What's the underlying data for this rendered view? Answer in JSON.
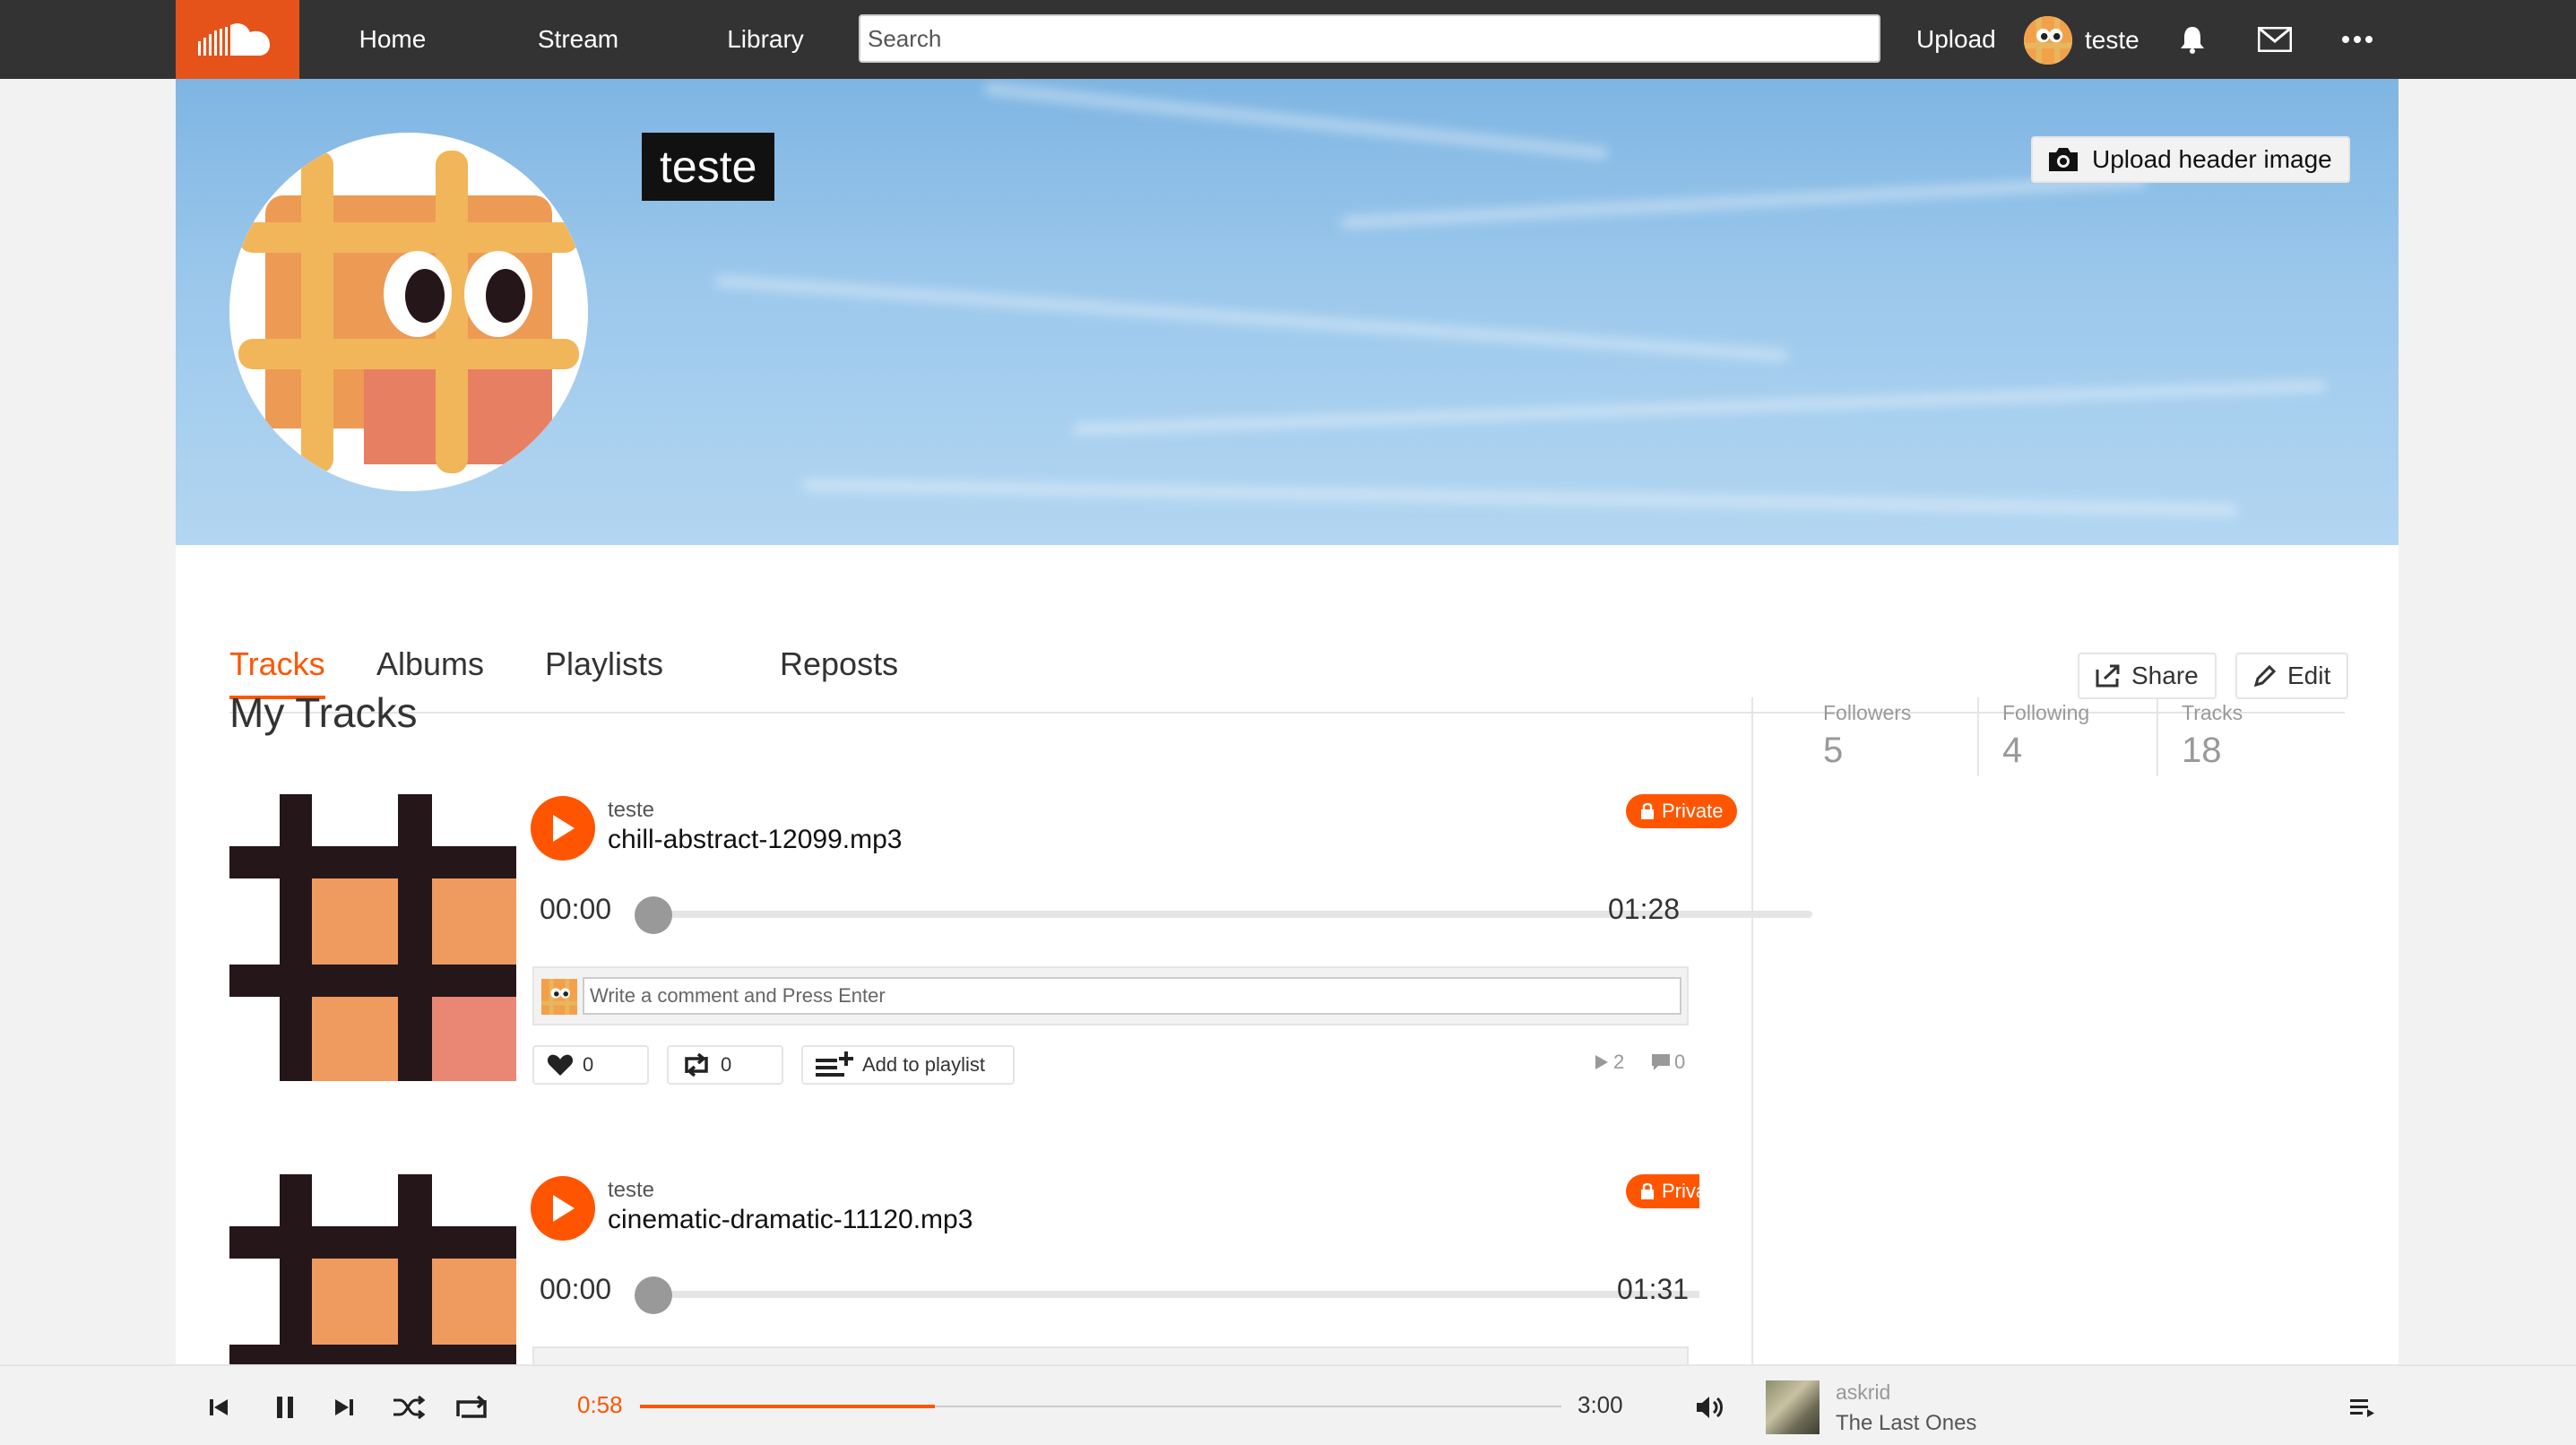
{
  "nav": {
    "home": "Home",
    "stream": "Stream",
    "library": "Library",
    "search_placeholder": "Search",
    "upload": "Upload",
    "username": "teste",
    "icons": [
      "bell-icon",
      "mail-icon",
      "more-icon"
    ]
  },
  "profile": {
    "name": "teste",
    "upload_header_label": "Upload header image"
  },
  "tabs": [
    "Tracks",
    "Albums",
    "Playlists",
    "Reposts"
  ],
  "active_tab": "Tracks",
  "actions": {
    "share": "Share",
    "edit": "Edit"
  },
  "section_title": "My Tracks",
  "stats": [
    {
      "label": "Followers",
      "value": "5"
    },
    {
      "label": "Following",
      "value": "4"
    },
    {
      "label": "Tracks",
      "value": "18"
    }
  ],
  "tracks": [
    {
      "user": "teste",
      "title": "chill-abstract-12099.mp3",
      "badge": "Private",
      "time_start": "00:00",
      "time_end": "01:28",
      "comment_placeholder": "Write a comment and Press Enter",
      "likes": "0",
      "reposts": "0",
      "add_to_playlist": "Add to playlist",
      "plays": "2",
      "comments": "0"
    },
    {
      "user": "teste",
      "title": "cinematic-dramatic-11120.mp3",
      "badge": "Private",
      "time_start": "00:00",
      "time_end": "01:31"
    }
  ],
  "player": {
    "elapsed": "0:58",
    "duration": "3:00",
    "progress": 0.32,
    "artist": "askrid",
    "song": "The Last Ones"
  },
  "colors": {
    "accent": "#ff5500",
    "topbar": "#333333",
    "logo_bg": "#e5531a"
  }
}
